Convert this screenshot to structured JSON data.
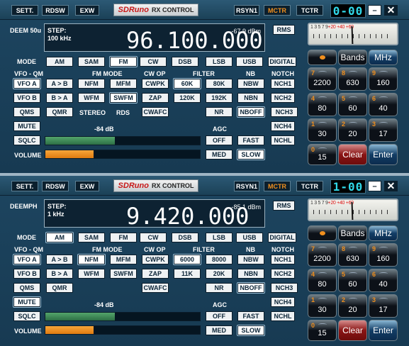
{
  "windows": [
    {
      "tb": {
        "sett": "SETT.",
        "rdsw": "RDSW",
        "exw": "EXW",
        "logo": "SDRuno",
        "title": "RX CONTROL",
        "rsyn": "RSYN1",
        "mctr": "MCTR",
        "tctr": "TCTR",
        "lcd": "0-00",
        "min": "–",
        "close": "✕"
      },
      "deemph": "DEEM 50u",
      "step_lbl": "STEP:",
      "step_val": "100 kHz",
      "freq": "96.100.000",
      "dbm": "-67.9 dBm",
      "rms": "RMS",
      "mode_lbl": "MODE",
      "modes": [
        "AM",
        "SAM",
        "FM",
        "CW",
        "DSB",
        "LSB",
        "USB",
        "DIGITAL"
      ],
      "mode_sel": 2,
      "hdr": {
        "vfo": "VFO - QM",
        "fm": "FM MODE",
        "cw": "CW OP",
        "filter": "FILTER",
        "nb": "NB",
        "notch": "NOTCH"
      },
      "r1": [
        "VFO A",
        "A > B",
        "NFM",
        "MFM",
        "CWPK",
        "60K",
        "80K",
        "NBW",
        "NCH1"
      ],
      "r1_sel": [
        0,
        5
      ],
      "r2": [
        "VFO B",
        "B > A",
        "WFM",
        "SWFM",
        "ZAP",
        "120K",
        "192K",
        "NBN",
        "NCH2"
      ],
      "r2_sel": [
        3
      ],
      "r3": [
        "QMS",
        "QMR",
        "CWAFC",
        "NR",
        "NBOFF",
        "NCH3"
      ],
      "r3_sel": [
        4
      ],
      "stereo": "STEREO",
      "rds": "RDS",
      "mute": "MUTE",
      "mute_sel": false,
      "nch4": "NCH4",
      "sqlc": "SQLC",
      "sq_db": "-84 dB",
      "agc": "AGC",
      "agc_opts": [
        "OFF",
        "FAST",
        "MED",
        "SLOW"
      ],
      "agc_sel": 3,
      "nchl": "NCHL",
      "volume": "VOLUME",
      "sq_level": 0.45,
      "vol_level": 0.31,
      "meter": {
        "scale": "1  3  5  7  9",
        "red": "+20 +40 +60"
      },
      "kp": {
        "bands": "Bands",
        "mhz": "MHz",
        "keys": [
          {
            "d": "7",
            "v": "2200"
          },
          {
            "d": "8",
            "v": "630"
          },
          {
            "d": "9",
            "v": "160"
          },
          {
            "d": "4",
            "v": "80"
          },
          {
            "d": "5",
            "v": "60"
          },
          {
            "d": "6",
            "v": "40"
          },
          {
            "d": "1",
            "v": "30"
          },
          {
            "d": "2",
            "v": "20"
          },
          {
            "d": "3",
            "v": "17"
          }
        ],
        "zero": {
          "d": "0",
          "v": "15"
        },
        "clear": "Clear",
        "enter": "Enter"
      }
    },
    {
      "tb": {
        "sett": "SETT.",
        "rdsw": "RDSW",
        "exw": "EXW",
        "logo": "SDRuno",
        "title": "RX CONTROL",
        "rsyn": "RSYN1",
        "mctr": "MCTR",
        "tctr": "TCTR",
        "lcd": "1-00",
        "min": "–",
        "close": "✕"
      },
      "deemph": "DEEMPH",
      "step_lbl": "STEP:",
      "step_val": "1 kHz",
      "freq": "9.420.000",
      "dbm": "-85.1 dBm",
      "rms": "RMS",
      "mode_lbl": "MODE",
      "modes": [
        "AM",
        "SAM",
        "FM",
        "CW",
        "DSB",
        "LSB",
        "USB",
        "DIGITAL"
      ],
      "mode_sel": 0,
      "hdr": {
        "vfo": "VFO - QM",
        "fm": "FM MODE",
        "cw": "CW OP",
        "filter": "FILTER",
        "nb": "NB",
        "notch": "NOTCH"
      },
      "r1": [
        "VFO A",
        "A > B",
        "NFM",
        "MFM",
        "CWPK",
        "6000",
        "8000",
        "NBW",
        "NCH1"
      ],
      "r1_sel": [
        0,
        2,
        5
      ],
      "r2": [
        "VFO B",
        "B > A",
        "WFM",
        "SWFM",
        "ZAP",
        "11K",
        "20K",
        "NBN",
        "NCH2"
      ],
      "r2_sel": [],
      "r3": [
        "QMS",
        "QMR",
        "CWAFC",
        "NR",
        "NBOFF",
        "NCH3"
      ],
      "r3_sel": [
        4
      ],
      "stereo": "",
      "rds": "",
      "mute": "MUTE",
      "mute_sel": true,
      "nch4": "NCH4",
      "sqlc": "SQLC",
      "sq_db": "-84 dB",
      "agc": "AGC",
      "agc_opts": [
        "OFF",
        "FAST",
        "MED",
        "SLOW"
      ],
      "agc_sel": 3,
      "nchl": "NCHL",
      "volume": "VOLUME",
      "sq_level": 0.45,
      "vol_level": 0.31,
      "meter": {
        "scale": "1  3  5  7  9",
        "red": "+20 +40 +60"
      },
      "kp": {
        "bands": "Bands",
        "mhz": "MHz",
        "keys": [
          {
            "d": "7",
            "v": "2200"
          },
          {
            "d": "8",
            "v": "630"
          },
          {
            "d": "9",
            "v": "160"
          },
          {
            "d": "4",
            "v": "80"
          },
          {
            "d": "5",
            "v": "60"
          },
          {
            "d": "6",
            "v": "40"
          },
          {
            "d": "1",
            "v": "30"
          },
          {
            "d": "2",
            "v": "20"
          },
          {
            "d": "3",
            "v": "17"
          }
        ],
        "zero": {
          "d": "0",
          "v": "15"
        },
        "clear": "Clear",
        "enter": "Enter"
      }
    }
  ]
}
